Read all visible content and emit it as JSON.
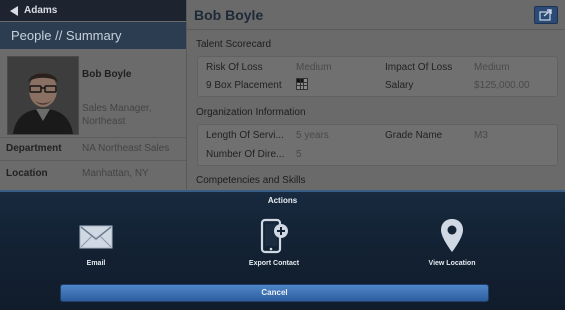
{
  "nav": {
    "back_label": "Adams"
  },
  "left": {
    "header": "People // Summary",
    "profile": {
      "name": "Bob Boyle",
      "title": "Sales Manager, Northeast"
    },
    "details": [
      {
        "label": "Department",
        "value": "NA Northeast Sales"
      },
      {
        "label": "Location",
        "value": "Manhattan, NY"
      }
    ]
  },
  "main": {
    "title": "Bob Boyle",
    "sections": [
      {
        "title": "Talent Scorecard",
        "rows": [
          {
            "k1": "Risk Of Loss",
            "v1": "Medium",
            "k2": "Impact Of Loss",
            "v2": "Medium"
          },
          {
            "k1": "9 Box Placement",
            "v1": "",
            "k2": "Salary",
            "v2": "$125,000.00"
          }
        ]
      },
      {
        "title": "Organization Information",
        "rows": [
          {
            "k1": "Length Of Servi...",
            "v1": "5 years",
            "k2": "Grade Name",
            "v2": "M3"
          },
          {
            "k1": "Number Of Dire...",
            "v1": "5",
            "k2": "",
            "v2": ""
          }
        ]
      },
      {
        "title": "Competencies and Skills"
      }
    ],
    "nine_box": {
      "rows": 3,
      "cols": 3,
      "highlight": [
        0,
        1
      ]
    }
  },
  "sheet": {
    "title": "Actions",
    "actions": [
      {
        "label": "Email",
        "icon": "envelope-icon"
      },
      {
        "label": "Export Contact",
        "icon": "phone-add-icon"
      },
      {
        "label": "View Location",
        "icon": "map-pin-icon"
      }
    ],
    "cancel_label": "Cancel"
  },
  "colors": {
    "sheet_bg": "#132234",
    "cancel_button": "#3b6fb0",
    "left_header_bg": "#2c3d52"
  }
}
